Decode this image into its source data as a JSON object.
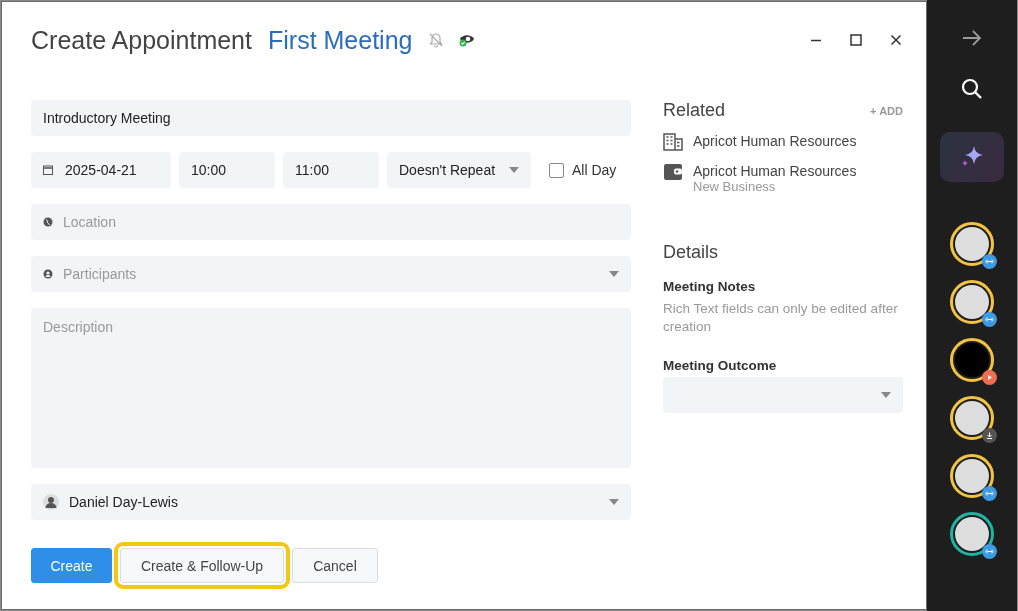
{
  "dialog": {
    "title": "Create Appointment",
    "subject": "First Meeting"
  },
  "form": {
    "title_field": {
      "value": "Introductory Meeting"
    },
    "date": {
      "value": "2025-04-21"
    },
    "start_time": {
      "value": "10:00"
    },
    "end_time": {
      "value": "11:00"
    },
    "repeat": {
      "value": "Doesn't Repeat"
    },
    "all_day": {
      "label": "All Day",
      "checked": false
    },
    "location": {
      "placeholder": "Location"
    },
    "participants": {
      "placeholder": "Participants"
    },
    "description": {
      "placeholder": "Description"
    },
    "owner": {
      "value": "Daniel Day-Lewis"
    }
  },
  "buttons": [
    {
      "label": "Create",
      "kind": "primary",
      "highlighted": false
    },
    {
      "label": "Create & Follow-Up",
      "kind": "secondary",
      "highlighted": true
    },
    {
      "label": "Cancel",
      "kind": "secondary",
      "highlighted": false
    }
  ],
  "related": {
    "title": "Related",
    "add": "+ ADD",
    "items": [
      {
        "kind": "company",
        "name": "Apricot Human Resources"
      },
      {
        "kind": "deal",
        "name": "Apricot Human Resources",
        "subtitle": "New Business"
      }
    ]
  },
  "details": {
    "title": "Details",
    "notes_label": "Meeting Notes",
    "notes_hint": "Rich Text fields can only be edited after creation",
    "outcome_label": "Meeting Outcome"
  },
  "rail": {
    "thumbnails": [
      {
        "color": "#f5c343",
        "kind": "link"
      },
      {
        "color": "#f5c343",
        "kind": "link"
      },
      {
        "color": "#f5c343",
        "kind": "play"
      },
      {
        "color": "#f5c343",
        "kind": "download"
      },
      {
        "color": "#f5c343",
        "kind": "link"
      },
      {
        "color": "#1fb5a5",
        "kind": "link"
      }
    ]
  }
}
